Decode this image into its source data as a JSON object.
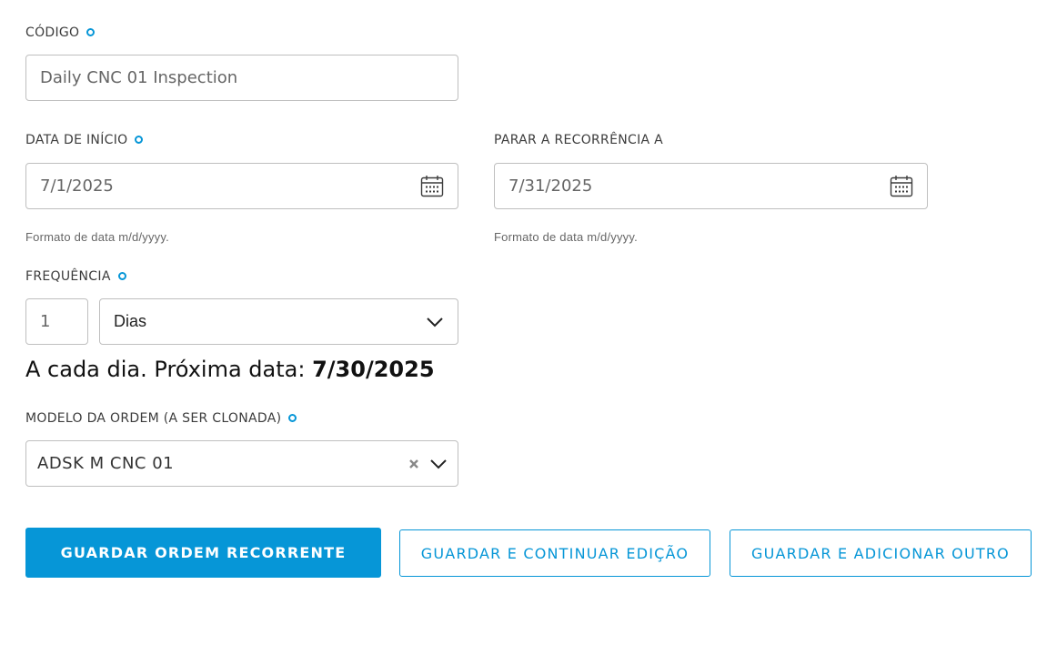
{
  "codigo": {
    "label": "CÓDIGO",
    "value": "Daily CNC 01 Inspection"
  },
  "start_date": {
    "label": "DATA DE INÍCIO",
    "value": "7/1/2025",
    "hint": "Formato de data m/d/yyyy.",
    "icon": "calendar-icon"
  },
  "stop_date": {
    "label": "PARAR A RECORRÊNCIA A",
    "value": "7/31/2025",
    "hint": "Formato de data m/d/yyyy.",
    "icon": "calendar-icon"
  },
  "frequency": {
    "label": "FREQUÊNCIA",
    "count": "1",
    "unit": "Dias"
  },
  "summary": {
    "text": "A cada dia. Próxima data: ",
    "next_date": "7/30/2025"
  },
  "template": {
    "label": "MODELO DA ORDEM (A SER CLONADA)",
    "value": "ADSK M CNC 01"
  },
  "buttons": {
    "save_recurring": "GUARDAR ORDEM RECORRENTE",
    "save_continue": "GUARDAR E CONTINUAR EDIÇÃO",
    "save_add": "GUARDAR E ADICIONAR OUTRO"
  },
  "colors": {
    "accent": "#0696d7",
    "border": "#bfbfbf",
    "text": "#3c3c3c"
  }
}
